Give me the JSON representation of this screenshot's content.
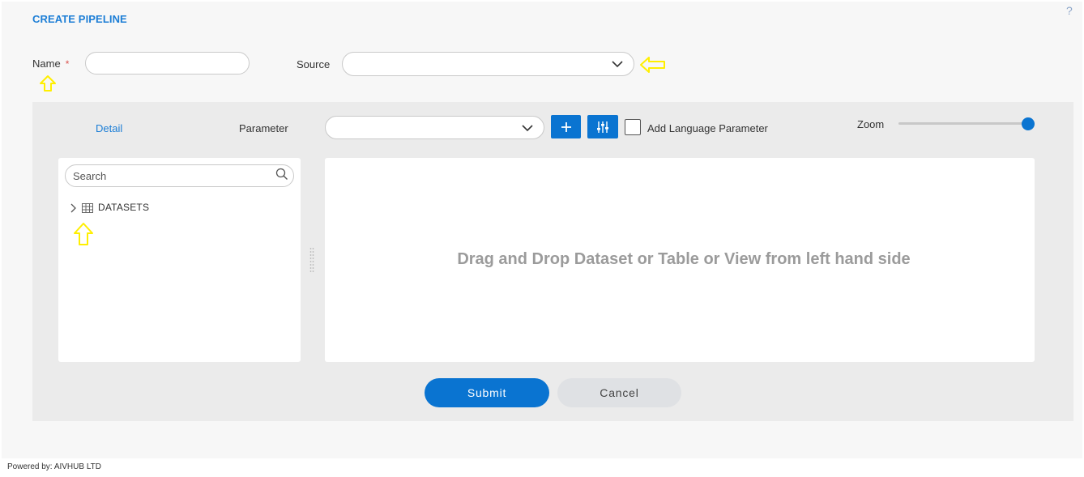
{
  "header": {
    "title": "CREATE PIPELINE",
    "help_icon": "?"
  },
  "form": {
    "name_label": "Name",
    "required_mark": "*",
    "name_value": "",
    "source_label": "Source",
    "source_value": ""
  },
  "toolbar": {
    "detail_tab": "Detail",
    "parameter_label": "Parameter",
    "parameter_value": "",
    "add_icon": "plus-icon",
    "settings_icon": "sliders-icon",
    "add_language_label": "Add Language Parameter",
    "add_language_checked": false,
    "zoom_label": "Zoom",
    "zoom_level": 1.0
  },
  "left_panel": {
    "search_placeholder": "Search",
    "tree": [
      {
        "label": "DATASETS",
        "icon": "table-grid-icon",
        "expanded": false
      }
    ]
  },
  "canvas": {
    "placeholder": "Drag and Drop Dataset or Table or View from left hand side"
  },
  "actions": {
    "submit_label": "Submit",
    "cancel_label": "Cancel"
  },
  "footer": {
    "text": "Powered by: AIVHUB LTD"
  },
  "colors": {
    "accent": "#0a74d1",
    "annotation_arrow": "#ffef00",
    "cancel_bg": "#dfe1e4"
  }
}
